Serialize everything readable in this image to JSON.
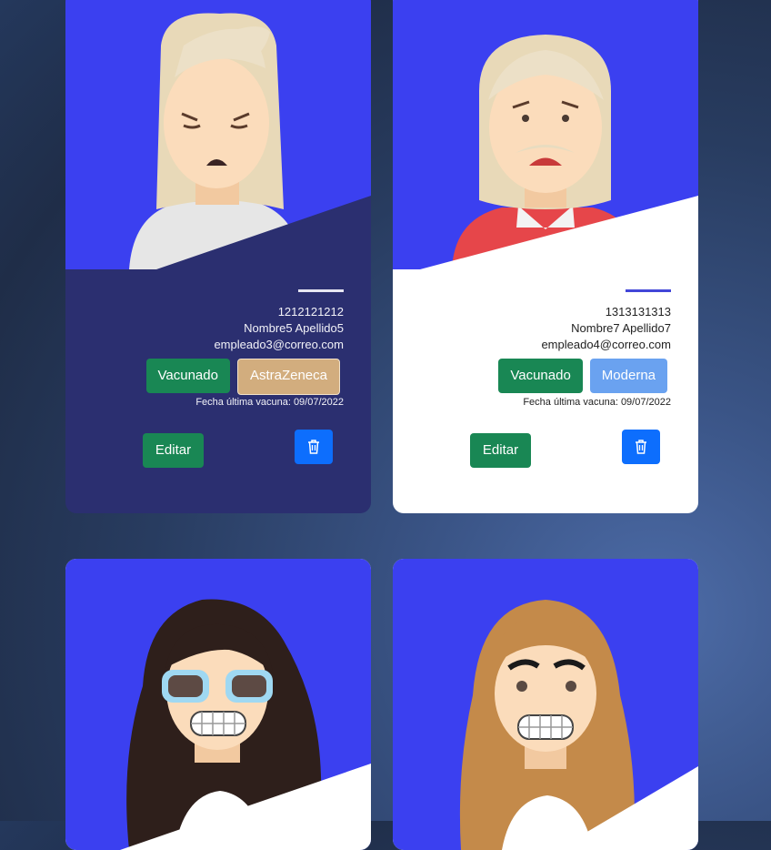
{
  "cards": [
    {
      "id_number": "1212121212",
      "name": "Nombre5 Apellido5",
      "email": "empleado3@correo.com",
      "status": "Vacunado",
      "vaccine": "AstraZeneca",
      "last_vaccine": "Fecha última vacuna: 09/07/2022",
      "edit_label": "Editar",
      "delete_icon": "trash-icon",
      "theme": "dark"
    },
    {
      "id_number": "1313131313",
      "name": "Nombre7 Apellido7",
      "email": "empleado4@correo.com",
      "status": "Vacunado",
      "vaccine": "Moderna",
      "last_vaccine": "Fecha última vacuna: 09/07/2022",
      "edit_label": "Editar",
      "delete_icon": "trash-icon",
      "theme": "light"
    },
    {
      "theme": "avatar-only"
    },
    {
      "theme": "avatar-only"
    }
  ],
  "colors": {
    "header_blue": "#3b40f0",
    "dark_card": "#2b2f70",
    "success_green": "#198754",
    "astra": "#d2ad7e",
    "moderna": "#6aa2f0",
    "delete_blue": "#0d6efd"
  }
}
